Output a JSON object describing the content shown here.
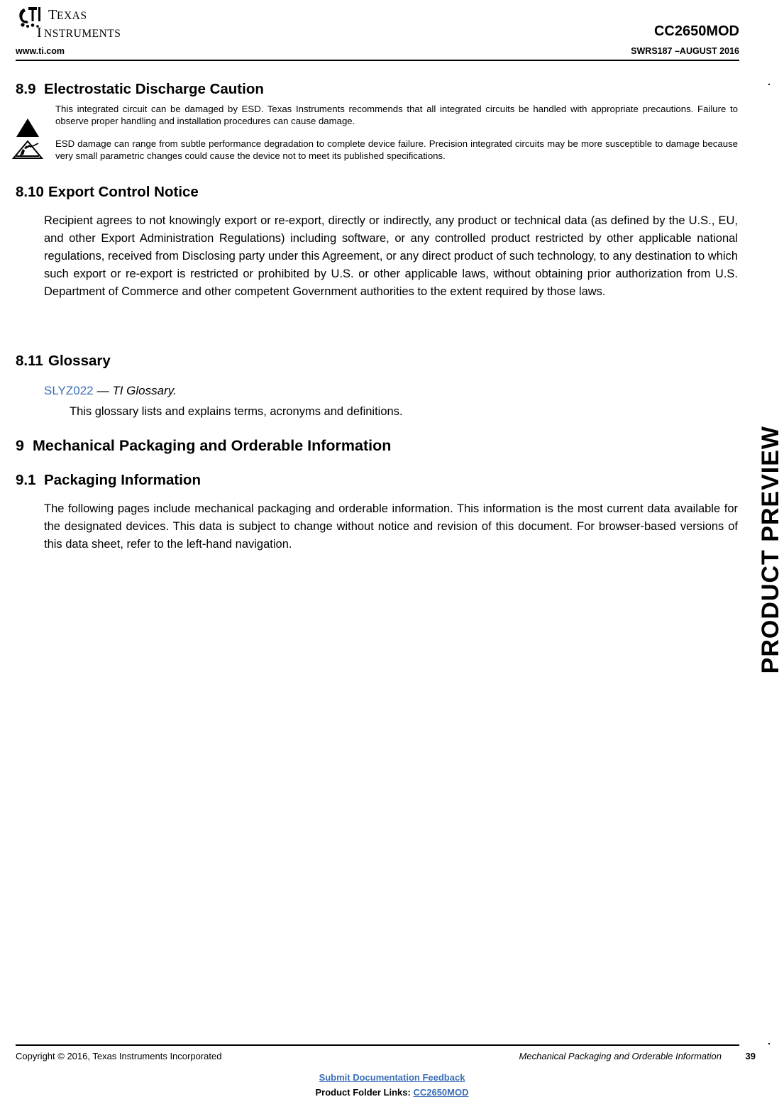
{
  "header": {
    "logo_line1": "TEXAS",
    "logo_line2": "INSTRUMENTS",
    "part_number": "CC2650MOD",
    "url": "www.ti.com",
    "doc_id": "SWRS187 –AUGUST 2016"
  },
  "sections": {
    "esd": {
      "number": "8.9",
      "title": "Electrostatic Discharge Caution",
      "para1": "This integrated circuit can be damaged by ESD. Texas Instruments recommends that all integrated circuits be handled with appropriate precautions. Failure to observe proper handling and installation procedures can cause damage.",
      "para2": "ESD damage can range from subtle performance degradation to complete device failure. Precision integrated circuits may be more susceptible to damage because very small parametric changes could cause the device not to meet its published specifications."
    },
    "export": {
      "number": "8.10",
      "title": "Export Control Notice",
      "para": "Recipient agrees to not knowingly export or re-export, directly or indirectly, any product or technical data (as defined by the U.S., EU, and other Export Administration Regulations) including software, or any controlled product restricted by other applicable national regulations, received from Disclosing party under this Agreement, or any direct product of such technology, to any destination to which such export or re-export is restricted or prohibited by U.S. or other applicable laws, without obtaining prior authorization from U.S. Department of Commerce and other competent Government authorities to the extent required by those laws."
    },
    "glossary": {
      "number": "8.11",
      "title": "Glossary",
      "link_label": "SLYZ022",
      "link_suffix": "— TI Glossary.",
      "body": "This glossary lists and explains terms, acronyms and definitions."
    },
    "mechanical": {
      "number": "9",
      "title": "Mechanical Packaging and Orderable Information"
    },
    "packaging": {
      "number": "9.1",
      "title": "Packaging Information",
      "para": "The following pages include mechanical packaging and orderable information. This information is the most current data available for the designated devices. This data is subject to change without notice and revision of this document. For browser-based versions of this data sheet, refer to the left-hand navigation."
    }
  },
  "sidebar": {
    "watermark": "PRODUCT PREVIEW"
  },
  "footer": {
    "copyright": "Copyright © 2016, Texas Instruments Incorporated",
    "section_name": "Mechanical Packaging and Orderable Information",
    "page_number": "39",
    "feedback": "Submit Documentation Feedback",
    "product_folder_prefix": "Product Folder Links: ",
    "product_folder_link": "CC2650MOD"
  }
}
